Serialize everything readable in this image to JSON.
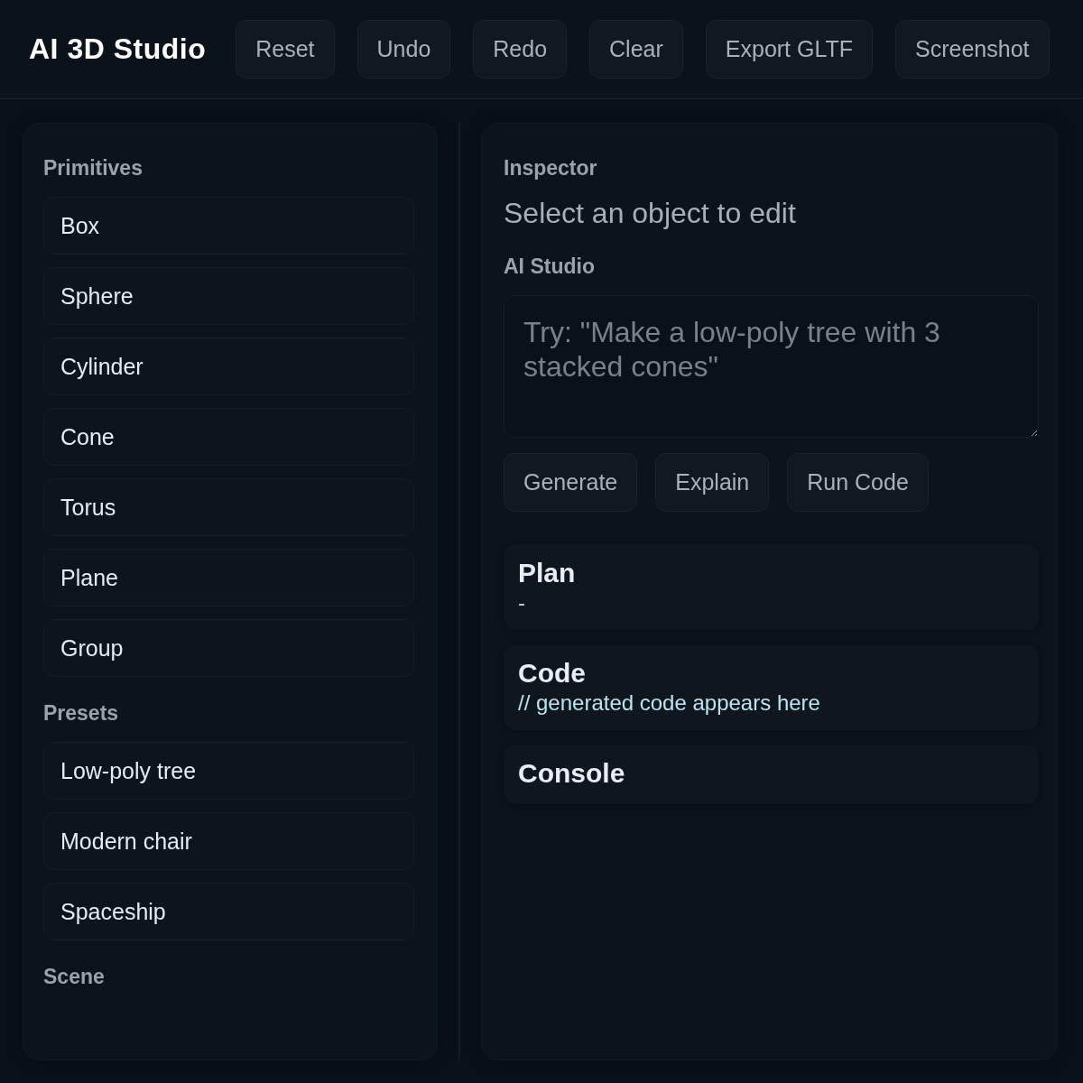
{
  "header": {
    "title": "AI 3D Studio",
    "buttons": [
      "Reset",
      "Undo",
      "Redo",
      "Clear",
      "Export GLTF",
      "Screenshot"
    ]
  },
  "sidebar": {
    "sections": [
      {
        "heading": "Primitives",
        "items": [
          "Box",
          "Sphere",
          "Cylinder",
          "Cone",
          "Torus",
          "Plane",
          "Group"
        ]
      },
      {
        "heading": "Presets",
        "items": [
          "Low-poly tree",
          "Modern chair",
          "Spaceship"
        ]
      },
      {
        "heading": "Scene"
      }
    ]
  },
  "inspector": {
    "heading": "Inspector",
    "message": "Select an object to edit"
  },
  "ai_studio": {
    "heading": "AI Studio",
    "prompt": {
      "placeholder": "Try: \"Make a low-poly tree with 3 stacked cones\""
    },
    "buttons": [
      "Generate",
      "Explain",
      "Run Code"
    ]
  },
  "output_cards": [
    {
      "title": "Plan",
      "kind": "text",
      "body": "-"
    },
    {
      "title": "Code",
      "kind": "code",
      "body": "// generated code appears here"
    },
    {
      "title": "Console"
    }
  ]
}
